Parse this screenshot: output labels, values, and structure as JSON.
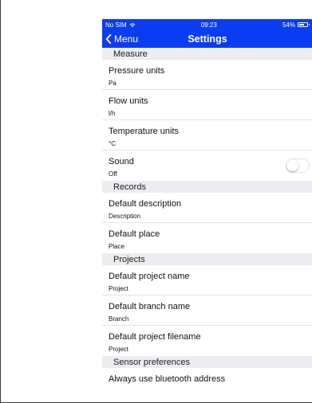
{
  "status_bar": {
    "carrier": "No SIM",
    "time": "09:23",
    "battery": "54%",
    "battery_level": 0.54,
    "wifi_icon": "wifi-icon",
    "battery_icon": "battery-icon"
  },
  "nav": {
    "back_label": "Menu",
    "back_icon": "chevron-left-icon",
    "title": "Settings",
    "color": "#0a3df2"
  },
  "sections": {
    "measure": {
      "header": "Measure",
      "pressure": {
        "title": "Pressure units",
        "value": "Pa"
      },
      "flow": {
        "title": "Flow units",
        "value": "l/h"
      },
      "temperature": {
        "title": "Temperature units",
        "value": "°C"
      },
      "sound": {
        "title": "Sound",
        "value": "Off",
        "enabled": false
      }
    },
    "records": {
      "header": "Records",
      "description": {
        "title": "Default description",
        "value": "Description"
      },
      "place": {
        "title": "Default place",
        "value": "Place"
      }
    },
    "projects": {
      "header": "Projects",
      "project_name": {
        "title": "Default project name",
        "value": "Project"
      },
      "branch_name": {
        "title": "Default branch name",
        "value": "Branch"
      },
      "project_filename": {
        "title": "Default project filename",
        "value": "Project"
      }
    },
    "sensor": {
      "header": "Sensor preferences",
      "bluetooth": {
        "title": "Always use bluetooth address"
      }
    }
  }
}
